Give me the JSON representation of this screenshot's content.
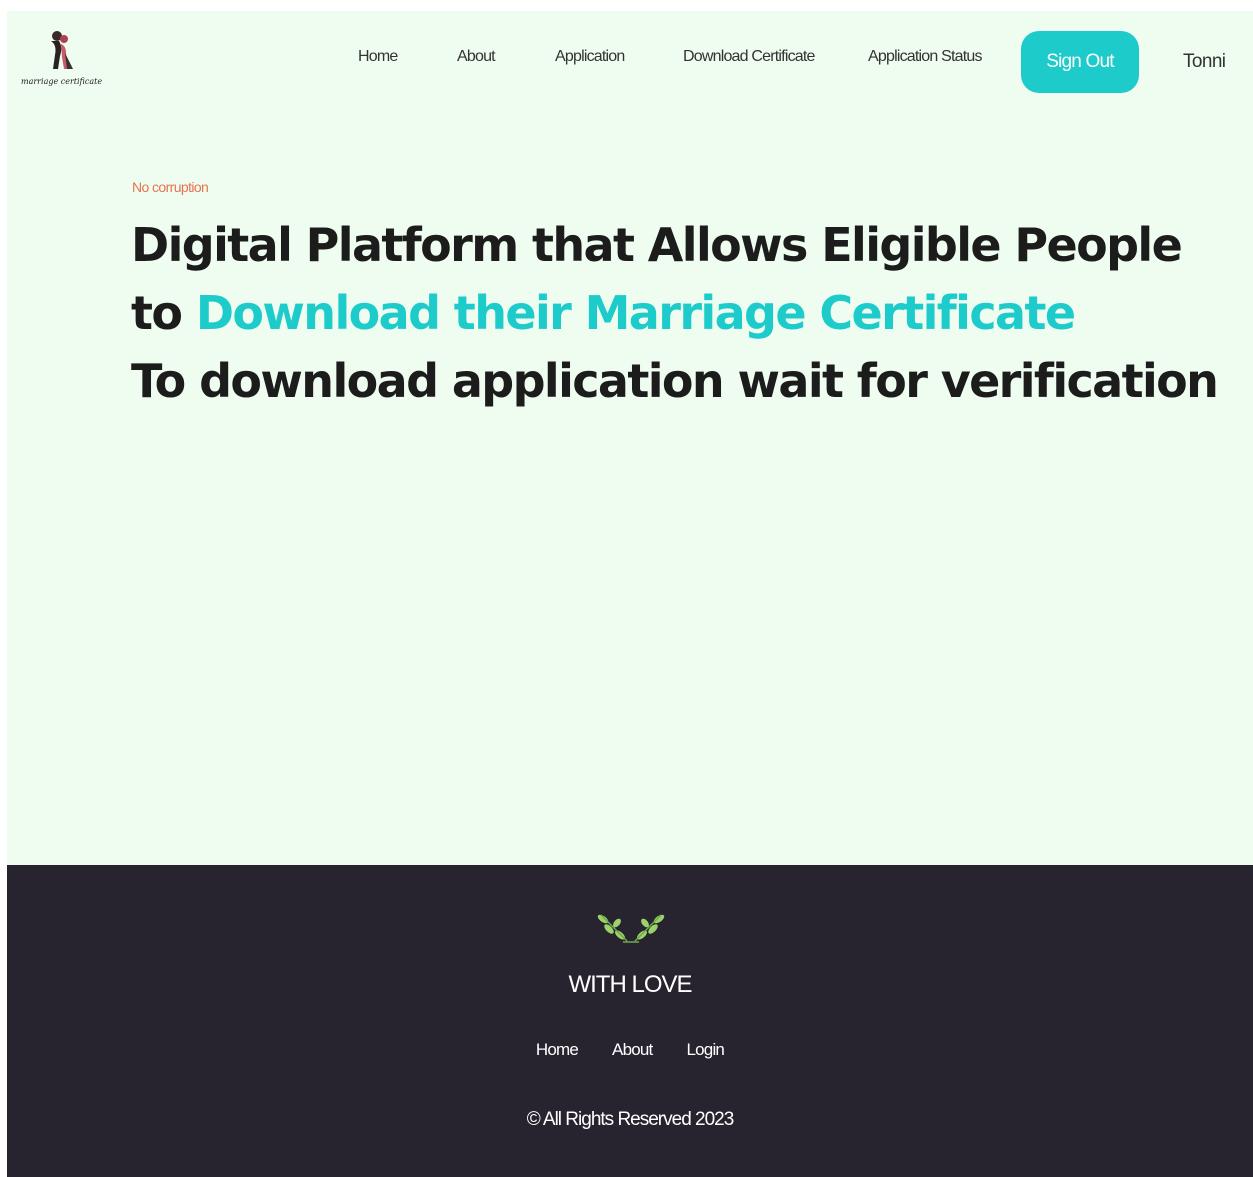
{
  "logo": {
    "text": "marriage certificate"
  },
  "nav": {
    "home": "Home",
    "about": "About",
    "application": "Application",
    "download_certificate": "Download Certificate",
    "application_status": "Application Status",
    "sign_out": "Sign Out",
    "username": "Tonni"
  },
  "hero": {
    "tagline": "No corruption",
    "line1": "Digital Platform that Allows Eligible People",
    "line2_prefix": "to",
    "line2_highlight": "Download their Marriage Certificate",
    "line3": "To download application wait for verification"
  },
  "footer": {
    "heading": "WITH LOVE",
    "links": {
      "home": "Home",
      "about": "About",
      "login": "Login"
    },
    "copyright": "© All Rights Reserved 2023"
  },
  "colors": {
    "accent": "#1ecbcb",
    "tagline": "#e6734f",
    "background": "#effdf0",
    "footer": "#28242f"
  },
  "icons": {
    "logo": "couple-icon",
    "footer": "laurel-leaf-icon"
  }
}
